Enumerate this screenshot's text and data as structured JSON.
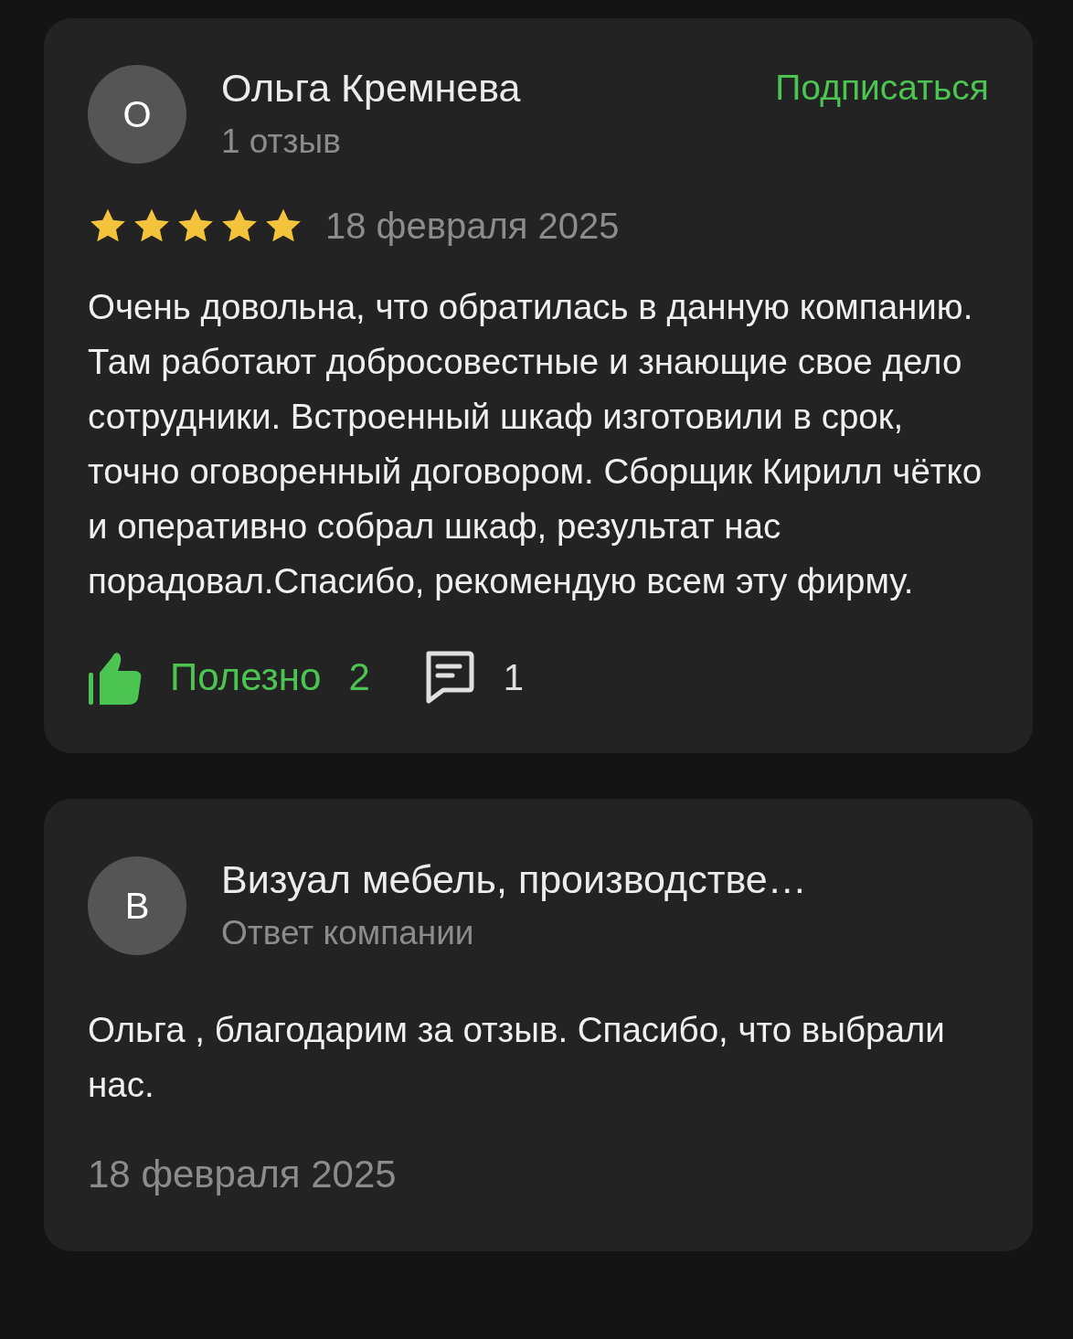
{
  "review": {
    "avatar_letter": "О",
    "author": "Ольга Кремнева",
    "review_count": "1 отзыв",
    "subscribe": "Подписаться",
    "stars": 5,
    "date": "18 февраля 2025",
    "text": "Очень довольна, что обратилась в данную компанию. Там работают добросовестные и знающие свое дело сотрудники. Встроенный шкаф изготовили в срок, точно оговоренный договором. Сборщик Кирилл чётко и оперативно собрал шкаф, результат нас порадовал.Спасибо, рекомендую всем эту фирму.",
    "useful_label": "Полезно",
    "useful_count": "2",
    "comments_count": "1"
  },
  "reply": {
    "avatar_letter": "В",
    "author": "Визуал мебель, производстве…",
    "subtitle": "Ответ компании",
    "text": "Ольга , благодарим за отзыв. Спасибо, что выбрали нас.",
    "date": "18 февраля 2025"
  }
}
